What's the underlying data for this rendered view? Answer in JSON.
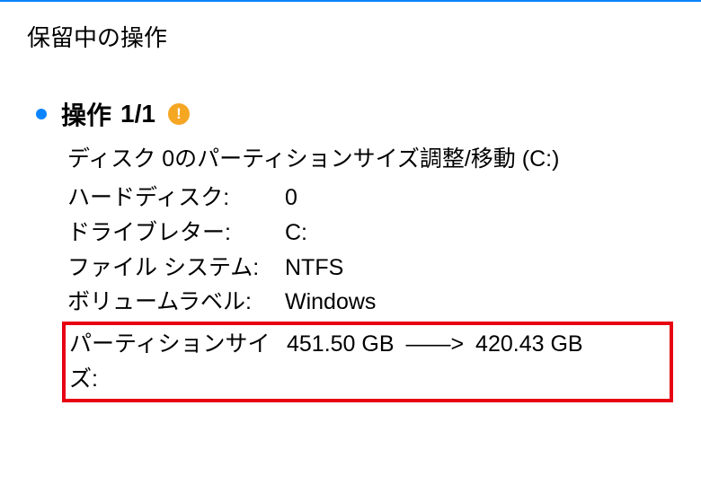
{
  "panel": {
    "title": "保留中の操作"
  },
  "operation": {
    "label": "操作",
    "count": "1/1"
  },
  "details": {
    "description": "ディスク 0のパーティションサイズ調整/移動 (C:)",
    "rows": {
      "hard_disk": {
        "label": "ハードディスク:",
        "value": "0"
      },
      "drive_letter": {
        "label": "ドライブレター:",
        "value": "C:"
      },
      "file_system": {
        "label": "ファイル システム:",
        "value": "NTFS"
      },
      "volume_label": {
        "label": "ボリュームラベル:",
        "value": "Windows"
      },
      "partition_size": {
        "label": "パーティションサイズ:",
        "from": "451.50 GB",
        "to": "420.43 GB",
        "arrow": "——>"
      }
    }
  }
}
